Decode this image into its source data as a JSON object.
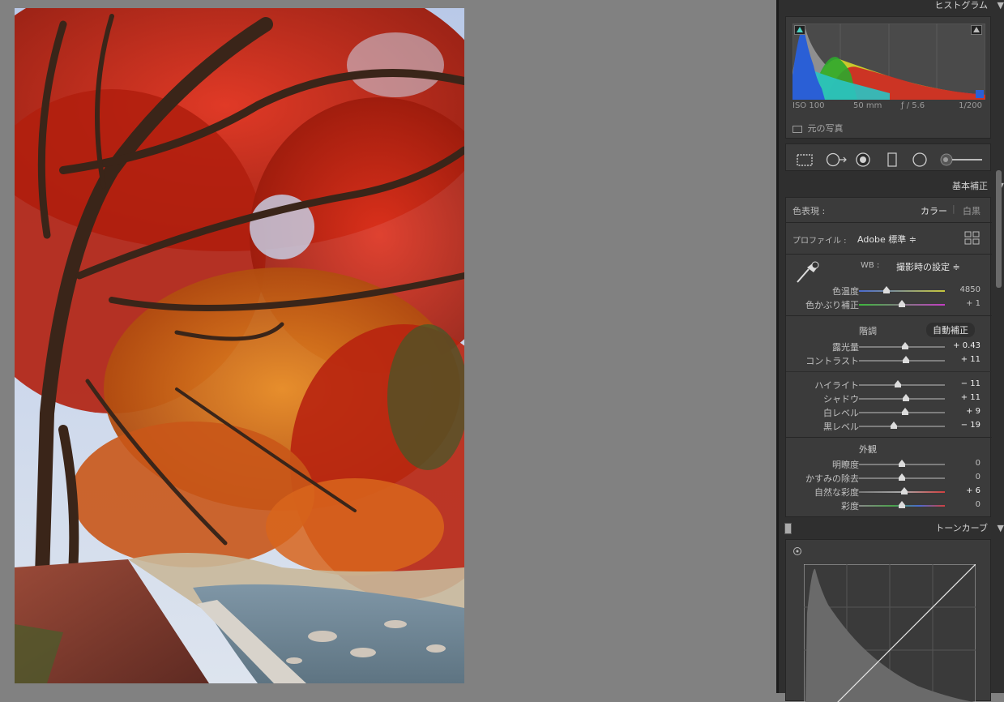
{
  "histogram": {
    "title": "ヒストグラム",
    "iso": "ISO 100",
    "focal": "50 mm",
    "aperture": "ƒ / 5.6",
    "shutter": "1/200",
    "original_photo_label": "元の写真"
  },
  "basic": {
    "title": "基本補正",
    "treatment_label": "色表現 :",
    "treatment_color": "カラー",
    "treatment_bw": "白黒",
    "profile_label": "プロファイル :",
    "profile_value": "Adobe 標準 ≑",
    "wb_label": "WB :",
    "wb_value": "撮影時の設定 ≑",
    "sliders_wb": [
      {
        "label": "色温度",
        "value": "4850",
        "level": 0.32
      },
      {
        "label": "色かぶり補正",
        "value": "+ 1",
        "level": 0.5
      }
    ],
    "tone_title": "階調",
    "auto_label": "自動補正",
    "sliders_tone": [
      {
        "label": "露光量",
        "value": "+ 0.43",
        "level": 0.54
      },
      {
        "label": "コントラスト",
        "value": "+ 11",
        "level": 0.55
      }
    ],
    "sliders_tone2": [
      {
        "label": "ハイライト",
        "value": "− 11",
        "level": 0.45
      },
      {
        "label": "シャドウ",
        "value": "+ 11",
        "level": 0.55
      },
      {
        "label": "白レベル",
        "value": "+ 9",
        "level": 0.54
      },
      {
        "label": "黒レベル",
        "value": "− 19",
        "level": 0.41
      }
    ],
    "presence_title": "外観",
    "sliders_presence": [
      {
        "label": "明瞭度",
        "value": "0",
        "level": 0.5
      },
      {
        "label": "かすみの除去",
        "value": "0",
        "level": 0.5
      },
      {
        "label": "自然な彩度",
        "value": "+ 6",
        "level": 0.53
      },
      {
        "label": "彩度",
        "value": "0",
        "level": 0.5
      }
    ]
  },
  "tonecurve": {
    "title": "トーンカーブ"
  }
}
